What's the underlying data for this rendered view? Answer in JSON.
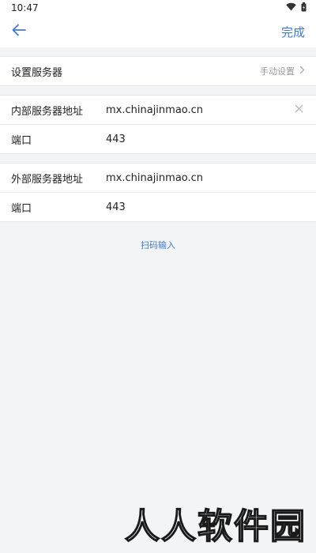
{
  "status_bar": {
    "time": "10:47"
  },
  "nav": {
    "done_label": "完成"
  },
  "server_setting": {
    "label": "设置服务器",
    "mode": "手动设置"
  },
  "internal": {
    "address_label": "内部服务器地址",
    "address_value": "mx.chinajinmao.cn",
    "port_label": "端口",
    "port_value": "443"
  },
  "external": {
    "address_label": "外部服务器地址",
    "address_value": "mx.chinajinmao.cn",
    "port_label": "端口",
    "port_value": "443"
  },
  "scan_label": "扫码输入",
  "watermark": "人人软件园"
}
